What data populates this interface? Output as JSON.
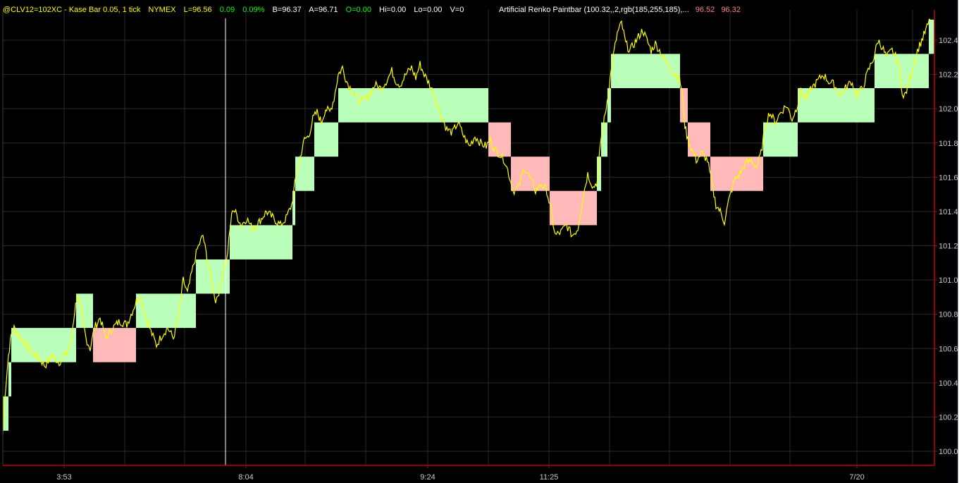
{
  "header": {
    "symbol": "@CLV12=102XC - Kase Bar 0.05, 1 tick",
    "exchange": "NYMEX",
    "last": "L=96.56",
    "net_change": "0.09",
    "pct_change": "0.09%",
    "bid": "B=96.37",
    "ask": "A=96.71",
    "open": "O=0.00",
    "high": "Hi=0.00",
    "low": "Lo=0.00",
    "volume": "V=0"
  },
  "study": {
    "name": "Artificial Renko Paintbar (100.32,,2,rgb(185,255,185),...",
    "value1": "96.52",
    "value2": "96.32"
  },
  "colors": {
    "background": "#000000",
    "price_line": "#ffff00",
    "up_brick": "#b9ffb9",
    "down_brick": "#ffb9b9",
    "grid": "#2a2a2a",
    "axis": "#c00000",
    "axis_label": "#c8c8c8",
    "header_text": "#ffff00",
    "header_green": "#00ff00",
    "header_white": "#ffffff",
    "study_text": "#ffffff",
    "study_value": "#ff8080"
  },
  "chart_data": {
    "type": "line",
    "title": "",
    "xlabel": "",
    "ylabel": "",
    "ylim": [
      99.95,
      102.55
    ],
    "xlim": [
      0,
      1360
    ],
    "y_ticks": [
      "102.4",
      "102.2",
      "102.0",
      "101.8",
      "101.6",
      "101.4",
      "101.2",
      "101.0",
      "100.8",
      "100.6",
      "100.4",
      "100.2",
      "100.0"
    ],
    "x_ticks": [
      {
        "label": "3:53",
        "x": 91
      },
      {
        "label": "8:04",
        "x": 349
      },
      {
        "label": "9:24",
        "x": 607
      },
      {
        "label": "11:25",
        "x": 779
      },
      {
        "label": "7/20",
        "x": 1216
      }
    ],
    "cursor_x": 320,
    "series": [
      {
        "values": [
          [
            4,
            100.1
          ],
          [
            6,
            100.28
          ],
          [
            9,
            100.42
          ],
          [
            12,
            100.56
          ],
          [
            16,
            100.68
          ],
          [
            20,
            100.72
          ],
          [
            26,
            100.68
          ],
          [
            34,
            100.64
          ],
          [
            44,
            100.58
          ],
          [
            54,
            100.55
          ],
          [
            64,
            100.5
          ],
          [
            74,
            100.56
          ],
          [
            84,
            100.52
          ],
          [
            92,
            100.56
          ],
          [
            100,
            100.62
          ],
          [
            106,
            100.82
          ],
          [
            110,
            100.92
          ],
          [
            116,
            100.8
          ],
          [
            122,
            100.66
          ],
          [
            128,
            100.6
          ],
          [
            134,
            100.72
          ],
          [
            142,
            100.78
          ],
          [
            150,
            100.66
          ],
          [
            160,
            100.72
          ],
          [
            170,
            100.76
          ],
          [
            180,
            100.74
          ],
          [
            186,
            100.8
          ],
          [
            192,
            100.86
          ],
          [
            198,
            100.92
          ],
          [
            206,
            100.8
          ],
          [
            214,
            100.7
          ],
          [
            222,
            100.62
          ],
          [
            230,
            100.68
          ],
          [
            238,
            100.72
          ],
          [
            246,
            100.66
          ],
          [
            254,
            100.8
          ],
          [
            260,
            101.0
          ],
          [
            266,
            100.92
          ],
          [
            272,
            101.04
          ],
          [
            280,
            101.18
          ],
          [
            288,
            101.26
          ],
          [
            294,
            101.12
          ],
          [
            300,
            101.0
          ],
          [
            306,
            100.88
          ],
          [
            312,
            100.95
          ],
          [
            318,
            101.08
          ],
          [
            322,
            101.12
          ],
          [
            326,
            101.28
          ],
          [
            330,
            101.42
          ],
          [
            336,
            101.38
          ],
          [
            342,
            101.32
          ],
          [
            350,
            101.36
          ],
          [
            358,
            101.3
          ],
          [
            368,
            101.34
          ],
          [
            378,
            101.4
          ],
          [
            388,
            101.36
          ],
          [
            398,
            101.32
          ],
          [
            406,
            101.36
          ],
          [
            414,
            101.44
          ],
          [
            420,
            101.6
          ],
          [
            426,
            101.72
          ],
          [
            432,
            101.82
          ],
          [
            438,
            101.84
          ],
          [
            444,
            101.94
          ],
          [
            450,
            101.98
          ],
          [
            456,
            101.92
          ],
          [
            462,
            102.0
          ],
          [
            468,
            101.98
          ],
          [
            474,
            102.06
          ],
          [
            480,
            102.2
          ],
          [
            486,
            102.24
          ],
          [
            492,
            102.16
          ],
          [
            500,
            102.1
          ],
          [
            508,
            102.06
          ],
          [
            516,
            102.04
          ],
          [
            524,
            102.08
          ],
          [
            532,
            102.14
          ],
          [
            540,
            102.12
          ],
          [
            548,
            102.16
          ],
          [
            556,
            102.22
          ],
          [
            562,
            102.16
          ],
          [
            568,
            102.14
          ],
          [
            576,
            102.2
          ],
          [
            584,
            102.24
          ],
          [
            590,
            102.18
          ],
          [
            596,
            102.26
          ],
          [
            602,
            102.2
          ],
          [
            610,
            102.14
          ],
          [
            618,
            102.06
          ],
          [
            626,
            101.96
          ],
          [
            634,
            101.88
          ],
          [
            642,
            101.86
          ],
          [
            650,
            101.92
          ],
          [
            658,
            101.84
          ],
          [
            666,
            101.78
          ],
          [
            674,
            101.84
          ],
          [
            682,
            101.8
          ],
          [
            690,
            101.78
          ],
          [
            696,
            101.82
          ],
          [
            702,
            101.76
          ],
          [
            708,
            101.74
          ],
          [
            716,
            101.7
          ],
          [
            722,
            101.62
          ],
          [
            728,
            101.52
          ],
          [
            736,
            101.54
          ],
          [
            744,
            101.66
          ],
          [
            752,
            101.6
          ],
          [
            760,
            101.52
          ],
          [
            768,
            101.56
          ],
          [
            776,
            101.52
          ],
          [
            782,
            101.4
          ],
          [
            788,
            101.26
          ],
          [
            796,
            101.28
          ],
          [
            804,
            101.32
          ],
          [
            812,
            101.26
          ],
          [
            820,
            101.3
          ],
          [
            828,
            101.5
          ],
          [
            834,
            101.62
          ],
          [
            842,
            101.54
          ],
          [
            848,
            101.58
          ],
          [
            852,
            101.8
          ],
          [
            856,
            101.9
          ],
          [
            860,
            102.0
          ],
          [
            866,
            102.18
          ],
          [
            870,
            102.3
          ],
          [
            876,
            102.44
          ],
          [
            882,
            102.5
          ],
          [
            888,
            102.38
          ],
          [
            894,
            102.34
          ],
          [
            900,
            102.38
          ],
          [
            906,
            102.42
          ],
          [
            912,
            102.46
          ],
          [
            918,
            102.4
          ],
          [
            924,
            102.34
          ],
          [
            930,
            102.38
          ],
          [
            936,
            102.34
          ],
          [
            944,
            102.28
          ],
          [
            952,
            102.24
          ],
          [
            958,
            102.2
          ],
          [
            964,
            102.18
          ],
          [
            968,
            102.1
          ],
          [
            972,
            101.9
          ],
          [
            976,
            101.82
          ],
          [
            982,
            101.76
          ],
          [
            988,
            101.7
          ],
          [
            996,
            101.74
          ],
          [
            1004,
            101.7
          ],
          [
            1010,
            101.56
          ],
          [
            1016,
            101.44
          ],
          [
            1022,
            101.4
          ],
          [
            1028,
            101.34
          ],
          [
            1034,
            101.46
          ],
          [
            1042,
            101.58
          ],
          [
            1050,
            101.62
          ],
          [
            1058,
            101.68
          ],
          [
            1066,
            101.7
          ],
          [
            1074,
            101.66
          ],
          [
            1080,
            101.74
          ],
          [
            1086,
            101.9
          ],
          [
            1092,
            101.98
          ],
          [
            1100,
            101.92
          ],
          [
            1108,
            101.98
          ],
          [
            1116,
            102.02
          ],
          [
            1124,
            101.94
          ],
          [
            1130,
            102.0
          ],
          [
            1136,
            102.1
          ],
          [
            1144,
            102.06
          ],
          [
            1152,
            102.12
          ],
          [
            1160,
            102.16
          ],
          [
            1168,
            102.2
          ],
          [
            1176,
            102.16
          ],
          [
            1184,
            102.14
          ],
          [
            1192,
            102.08
          ],
          [
            1200,
            102.12
          ],
          [
            1208,
            102.16
          ],
          [
            1216,
            102.08
          ],
          [
            1224,
            102.12
          ],
          [
            1232,
            102.22
          ],
          [
            1240,
            102.3
          ],
          [
            1246,
            102.4
          ],
          [
            1252,
            102.36
          ],
          [
            1258,
            102.3
          ],
          [
            1266,
            102.34
          ],
          [
            1274,
            102.28
          ],
          [
            1282,
            102.06
          ],
          [
            1288,
            102.12
          ],
          [
            1296,
            102.26
          ],
          [
            1302,
            102.34
          ],
          [
            1308,
            102.4
          ],
          [
            1314,
            102.46
          ],
          [
            1320,
            102.52
          ]
        ]
      }
    ],
    "bricks": [
      {
        "x0": 4,
        "x1": 12,
        "y0": 100.12,
        "y1": 100.32,
        "dir": "up"
      },
      {
        "x0": 12,
        "x1": 16,
        "y0": 100.32,
        "y1": 100.52,
        "dir": "up"
      },
      {
        "x0": 16,
        "x1": 108,
        "y0": 100.52,
        "y1": 100.72,
        "dir": "up"
      },
      {
        "x0": 108,
        "x1": 132,
        "y0": 100.72,
        "y1": 100.92,
        "dir": "up"
      },
      {
        "x0": 132,
        "x1": 193,
        "y0": 100.72,
        "y1": 100.52,
        "dir": "down"
      },
      {
        "x0": 193,
        "x1": 278,
        "y0": 100.72,
        "y1": 100.92,
        "dir": "up"
      },
      {
        "x0": 278,
        "x1": 326,
        "y0": 100.92,
        "y1": 101.12,
        "dir": "up"
      },
      {
        "x0": 326,
        "x1": 415,
        "y0": 101.12,
        "y1": 101.32,
        "dir": "up"
      },
      {
        "x0": 415,
        "x1": 419,
        "y0": 101.32,
        "y1": 101.52,
        "dir": "up"
      },
      {
        "x0": 419,
        "x1": 446,
        "y0": 101.52,
        "y1": 101.72,
        "dir": "up"
      },
      {
        "x0": 446,
        "x1": 480,
        "y0": 101.72,
        "y1": 101.92,
        "dir": "up"
      },
      {
        "x0": 480,
        "x1": 693,
        "y0": 101.92,
        "y1": 102.12,
        "dir": "up"
      },
      {
        "x0": 693,
        "x1": 725,
        "y0": 101.92,
        "y1": 101.72,
        "dir": "down"
      },
      {
        "x0": 725,
        "x1": 780,
        "y0": 101.72,
        "y1": 101.52,
        "dir": "down"
      },
      {
        "x0": 780,
        "x1": 847,
        "y0": 101.52,
        "y1": 101.32,
        "dir": "down"
      },
      {
        "x0": 847,
        "x1": 853,
        "y0": 101.52,
        "y1": 101.72,
        "dir": "up"
      },
      {
        "x0": 853,
        "x1": 862,
        "y0": 101.72,
        "y1": 101.92,
        "dir": "up"
      },
      {
        "x0": 862,
        "x1": 867,
        "y0": 101.92,
        "y1": 102.12,
        "dir": "up"
      },
      {
        "x0": 867,
        "x1": 965,
        "y0": 102.12,
        "y1": 102.32,
        "dir": "up"
      },
      {
        "x0": 965,
        "x1": 976,
        "y0": 102.12,
        "y1": 101.92,
        "dir": "down"
      },
      {
        "x0": 976,
        "x1": 1008,
        "y0": 101.92,
        "y1": 101.72,
        "dir": "down"
      },
      {
        "x0": 1008,
        "x1": 1083,
        "y0": 101.72,
        "y1": 101.52,
        "dir": "down"
      },
      {
        "x0": 1083,
        "x1": 1132,
        "y0": 101.72,
        "y1": 101.92,
        "dir": "up"
      },
      {
        "x0": 1132,
        "x1": 1241,
        "y0": 101.92,
        "y1": 102.12,
        "dir": "up"
      },
      {
        "x0": 1241,
        "x1": 1318,
        "y0": 102.12,
        "y1": 102.32,
        "dir": "up"
      },
      {
        "x0": 1318,
        "x1": 1326,
        "y0": 102.32,
        "y1": 102.52,
        "dir": "up"
      }
    ]
  }
}
